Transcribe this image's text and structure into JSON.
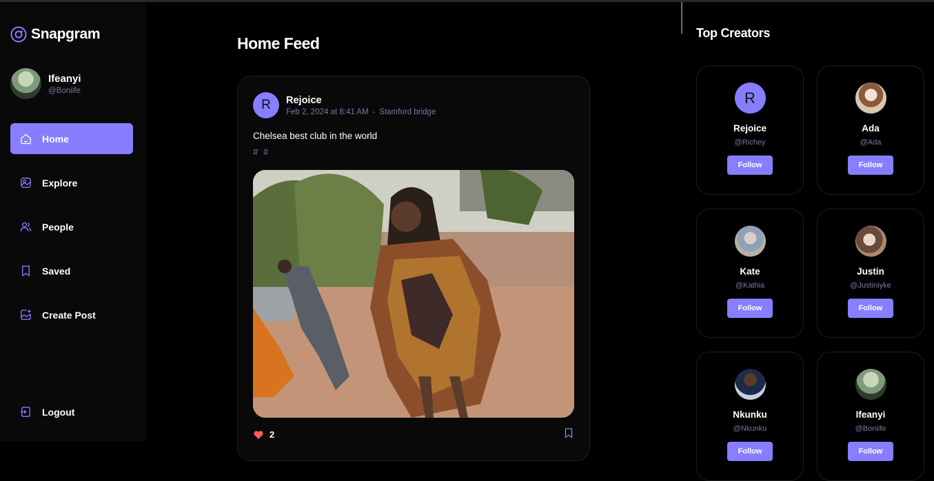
{
  "app": {
    "name": "Snapgram",
    "accent": "#877eff",
    "muted": "#7878a3"
  },
  "user": {
    "name": "Ifeanyi",
    "handle": "@Boniife"
  },
  "nav": {
    "items": [
      {
        "label": "Home",
        "icon": "home-icon",
        "active": true
      },
      {
        "label": "Explore",
        "icon": "explore-icon"
      },
      {
        "label": "People",
        "icon": "people-icon"
      },
      {
        "label": "Saved",
        "icon": "bookmark-icon"
      },
      {
        "label": "Create Post",
        "icon": "create-post-icon"
      }
    ],
    "logout": "Logout"
  },
  "feed": {
    "title": "Home Feed",
    "post": {
      "author": "Rejoice",
      "initial": "R",
      "date": "Feb 2, 2024 at 8:41 AM",
      "separator": "-",
      "location": "Stamford bridge",
      "caption": "Chelsea best club in the world",
      "tags": "# #",
      "likes": "2"
    }
  },
  "creators": {
    "title": "Top Creators",
    "follow_label": "Follow",
    "list": [
      {
        "name": "Rejoice",
        "handle": "@Richey",
        "initial": "R"
      },
      {
        "name": "Ada",
        "handle": "@Ada"
      },
      {
        "name": "Kate",
        "handle": "@Kathia"
      },
      {
        "name": "Justin",
        "handle": "@Justiniyke"
      },
      {
        "name": "Nkunku",
        "handle": "@Nkunku"
      },
      {
        "name": "Ifeanyi",
        "handle": "@Boniife"
      }
    ]
  }
}
